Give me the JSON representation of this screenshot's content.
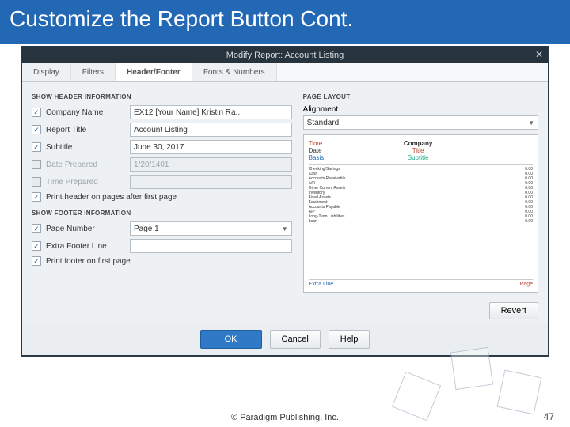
{
  "slide": {
    "title": "Customize the Report Button Cont.",
    "copyright": "© Paradigm Publishing, Inc.",
    "page_num": "47"
  },
  "dialog": {
    "title": "Modify Report: Account Listing",
    "tabs": {
      "display": "Display",
      "filters": "Filters",
      "hf": "Header/Footer",
      "fonts": "Fonts & Numbers"
    },
    "header_section": "SHOW HEADER INFORMATION",
    "footer_section": "SHOW FOOTER INFORMATION",
    "layout_section": "PAGE LAYOUT",
    "alignment_label": "Alignment",
    "alignment_value": "Standard",
    "fields": {
      "company": {
        "label": "Company Name",
        "value": "EX12 [Your Name] Kristin Ra..."
      },
      "title": {
        "label": "Report Title",
        "value": "Account Listing"
      },
      "subtitle": {
        "label": "Subtitle",
        "value": "June 30, 2017"
      },
      "date": {
        "label": "Date Prepared",
        "value": "1/20/1401"
      },
      "time": {
        "label": "Time Prepared",
        "value": ""
      },
      "print_after": {
        "label": "Print header on pages after first page"
      },
      "pagenum": {
        "label": "Page Number",
        "value": "Page 1"
      },
      "extraline": {
        "label": "Extra Footer Line",
        "value": ""
      },
      "print_first": {
        "label": "Print footer on first page"
      }
    },
    "preview": {
      "time": "Time",
      "date": "Date",
      "basis": "Basis",
      "company": "Company",
      "title": "Title",
      "subtitle": "Subtitle",
      "extra": "Extra Line",
      "page": "Page",
      "rows": [
        {
          "l": "Checking/Savings",
          "r": "0.00"
        },
        {
          "l": "   Cash",
          "r": "0.00"
        },
        {
          "l": "Accounts Receivable",
          "r": "0.00"
        },
        {
          "l": "   A/R",
          "r": "0.00"
        },
        {
          "l": "Other Current Assets",
          "r": "0.00"
        },
        {
          "l": "   Inventory",
          "r": "0.00"
        },
        {
          "l": "Fixed Assets",
          "r": "0.00"
        },
        {
          "l": "   Equipment",
          "r": "0.00"
        },
        {
          "l": "Accounts Payable",
          "r": "0.00"
        },
        {
          "l": "   A/P",
          "r": "0.00"
        },
        {
          "l": "Long-Term Liabilities",
          "r": "0.00"
        },
        {
          "l": "   Loan",
          "r": "0.00"
        }
      ]
    },
    "buttons": {
      "revert": "Revert",
      "ok": "OK",
      "cancel": "Cancel",
      "help": "Help"
    }
  }
}
